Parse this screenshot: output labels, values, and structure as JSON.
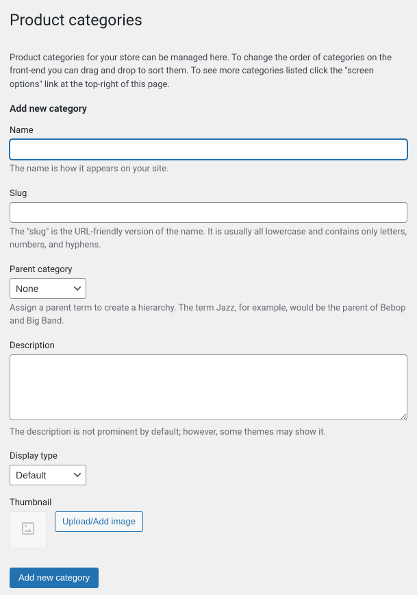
{
  "page": {
    "title": "Product categories",
    "intro": "Product categories for your store can be managed here. To change the order of categories on the front-end you can drag and drop to sort them. To see more categories listed click the \"screen options\" link at the top-right of this page."
  },
  "form": {
    "heading": "Add new category",
    "name": {
      "label": "Name",
      "value": "",
      "help": "The name is how it appears on your site."
    },
    "slug": {
      "label": "Slug",
      "value": "",
      "help": "The \"slug\" is the URL-friendly version of the name. It is usually all lowercase and contains only letters, numbers, and hyphens."
    },
    "parent": {
      "label": "Parent category",
      "selected": "None",
      "help": "Assign a parent term to create a hierarchy. The term Jazz, for example, would be the parent of Bebop and Big Band."
    },
    "description": {
      "label": "Description",
      "value": "",
      "help": "The description is not prominent by default; however, some themes may show it."
    },
    "display_type": {
      "label": "Display type",
      "selected": "Default"
    },
    "thumbnail": {
      "label": "Thumbnail",
      "upload_button": "Upload/Add image"
    },
    "submit": "Add new category"
  }
}
